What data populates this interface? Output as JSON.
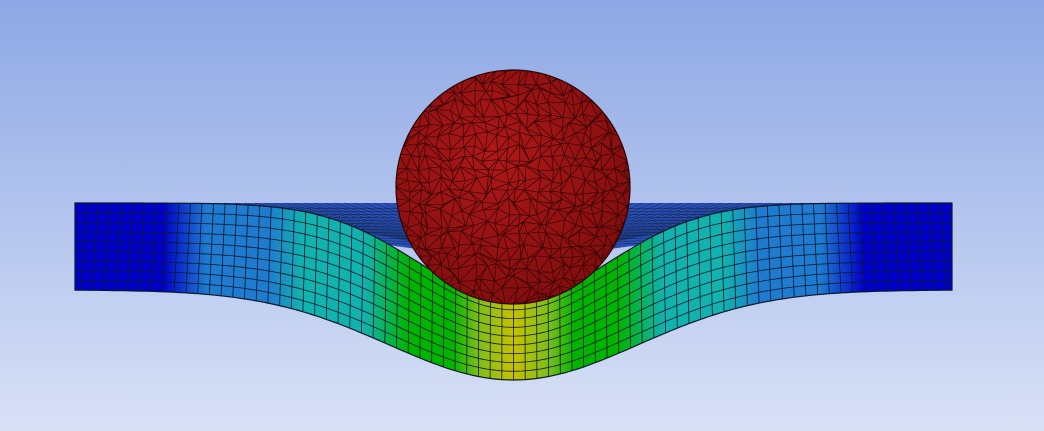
{
  "scene": {
    "background": {
      "top_color": "#8DA8E5",
      "bottom_color": "#D9E1F6"
    },
    "mesh_line_color": "#0B1A2A",
    "contour_colors": [
      "#0000C8",
      "#1E7BD0",
      "#12B2AE",
      "#00B400",
      "#7EBE1A",
      "#C8C000"
    ],
    "sphere_color": "#B01818",
    "sphere_edge_color": "#2A0303"
  }
}
